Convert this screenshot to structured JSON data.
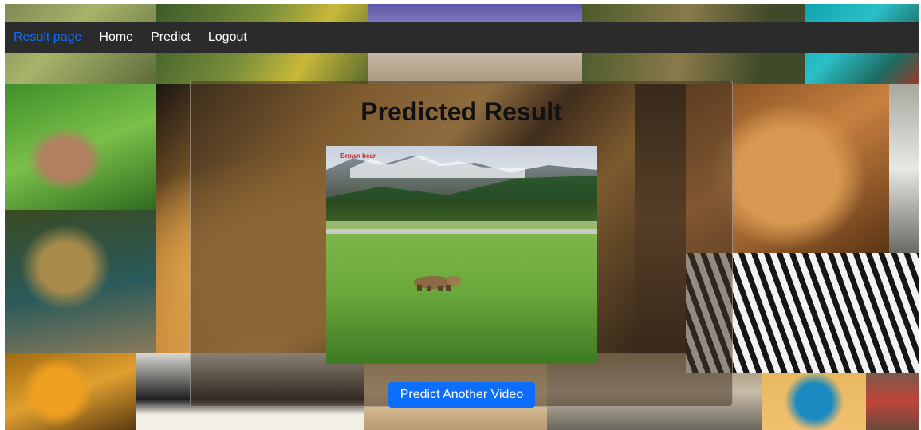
{
  "navbar": {
    "items": [
      {
        "label": "Result page",
        "active": true
      },
      {
        "label": "Home",
        "active": false
      },
      {
        "label": "Predict",
        "active": false
      },
      {
        "label": "Logout",
        "active": false
      }
    ]
  },
  "main": {
    "title": "Predicted Result",
    "video_overlay_label": "Brown bear",
    "button_label": "Predict Another Video"
  },
  "colors": {
    "accent": "#0d6efd",
    "navbar_bg": "#2b2b2b",
    "overlay_label": "#e01a1a"
  }
}
